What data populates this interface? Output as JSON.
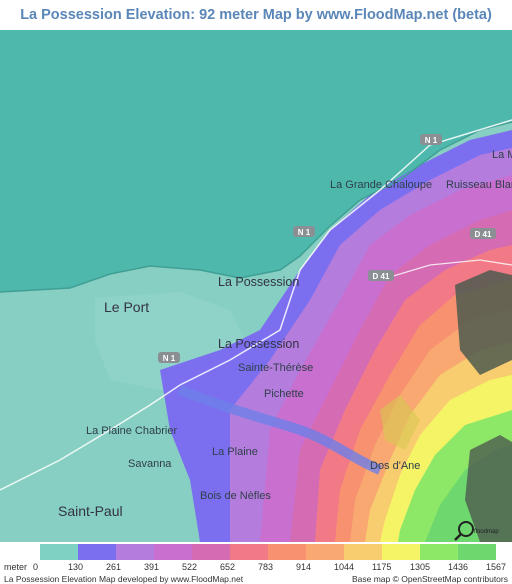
{
  "title": "La Possession Elevation: 92 meter Map by www.FloodMap.net (beta)",
  "map": {
    "places": [
      {
        "label": "La Mo"
      },
      {
        "label": "La Grande Chaloupe"
      },
      {
        "label": "Ruisseau Blanc"
      },
      {
        "label": "La Possession"
      },
      {
        "label": "Le Port"
      },
      {
        "label": "La Possession"
      },
      {
        "label": "Sainte-Thérèse"
      },
      {
        "label": "Pichette"
      },
      {
        "label": "La Plaine Chabrier"
      },
      {
        "label": "Savanna"
      },
      {
        "label": "La Plaine"
      },
      {
        "label": "Dos d'Ane"
      },
      {
        "label": "Bois de Nèfles"
      },
      {
        "label": "Saint-Paul"
      }
    ],
    "roads": [
      {
        "label": "N 1"
      },
      {
        "label": "N 1"
      },
      {
        "label": "D 41"
      },
      {
        "label": "D 41"
      },
      {
        "label": "N 1"
      }
    ],
    "logo_text": "floodmap"
  },
  "legend": {
    "unit": "meter",
    "ticks": [
      "0",
      "130",
      "261",
      "391",
      "522",
      "652",
      "783",
      "914",
      "1044",
      "1175",
      "1305",
      "1436",
      "1567"
    ],
    "colors": [
      "#7fd1c4",
      "#7b6ff0",
      "#b47ddd",
      "#c96fd0",
      "#d56cb3",
      "#f27a86",
      "#f7916f",
      "#f8a870",
      "#f8cd6f",
      "#f5f466",
      "#8de867",
      "#6ed86f"
    ]
  },
  "footer": {
    "left": "La Possession Elevation Map developed by www.FloodMap.net",
    "right": "Base map © OpenStreetMap contributors"
  },
  "colors": {
    "sea": "#4fb8ad",
    "title": "#5a86b8"
  }
}
